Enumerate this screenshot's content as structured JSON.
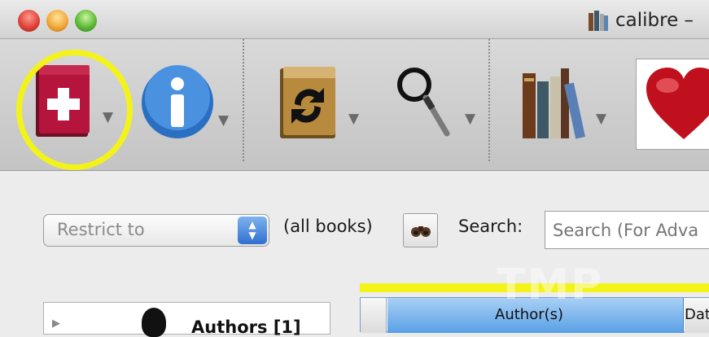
{
  "window": {
    "title": "calibre –"
  },
  "toolbar": {
    "buttons": [
      {
        "name": "add-books",
        "icon": "add-book-icon",
        "caret": "▼"
      },
      {
        "name": "edit-metadata",
        "icon": "info-icon",
        "caret": "▼"
      },
      {
        "name": "convert-books",
        "icon": "convert-book-icon",
        "caret": "▼"
      },
      {
        "name": "view",
        "icon": "magnifier-icon",
        "caret": "▼"
      },
      {
        "name": "library",
        "icon": "library-books-icon",
        "caret": "▼"
      },
      {
        "name": "donate",
        "icon": "heart-icon"
      }
    ]
  },
  "search_bar": {
    "restrict_label": "Restrict to",
    "all_books": "(all books)",
    "search_label": "Search:",
    "search_placeholder": "Search (For Adva"
  },
  "tag_browser": {
    "first_item": "Authors [1]"
  },
  "table": {
    "columns": [
      "",
      "Author(s)",
      "Date"
    ]
  },
  "watermark": "TMP",
  "colors": {
    "annotation_highlight": "#f3f31a",
    "column_header_selected": "#5aa0e6"
  }
}
